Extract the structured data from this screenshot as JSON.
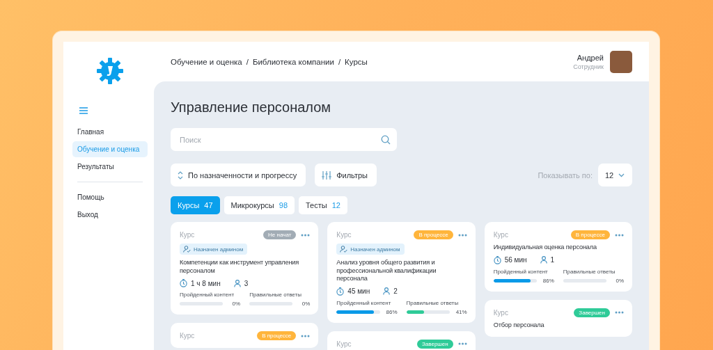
{
  "sidebar": {
    "items": [
      {
        "label": "Главная",
        "selected": false
      },
      {
        "label": "Обучение и оценка",
        "selected": true
      },
      {
        "label": "Результаты",
        "selected": false
      }
    ],
    "bottom_items": [
      {
        "label": "Помощь"
      },
      {
        "label": "Выход"
      }
    ]
  },
  "breadcrumbs": [
    "Обучение и оценка",
    "Библиотека компании",
    "Курсы"
  ],
  "breadcrumb_separator": "/",
  "user": {
    "name": "Андрей",
    "role": "Сотрудник"
  },
  "page_title": "Управление персоналом",
  "search": {
    "placeholder": "Поиск"
  },
  "sort_button": "По назначенности и прогрессу",
  "filter_button": "Фильтры",
  "page_size": {
    "label": "Показывать по:",
    "value": "12"
  },
  "tabs": [
    {
      "label": "Курсы",
      "count": "47",
      "selected": true
    },
    {
      "label": "Микрокурсы",
      "count": "98",
      "selected": false
    },
    {
      "label": "Тесты",
      "count": "12",
      "selected": false
    }
  ],
  "columns": [
    [
      {
        "type": "Курс",
        "status": {
          "label": "Не начат",
          "kind": "not_started"
        },
        "assigned": "Назначен админом",
        "title": "Компетенции как инструмент управления персоналом",
        "duration": "1 ч 8 мин",
        "people": "3",
        "metrics": [
          {
            "label": "Пройденный контент",
            "level": 0,
            "reading": "0%",
            "kind": "content"
          },
          {
            "label": "Правильные ответы",
            "level": 0,
            "reading": "0%",
            "kind": "answers"
          }
        ]
      },
      {
        "type": "Курс",
        "status": {
          "label": "В процессе",
          "kind": "in_progress"
        }
      }
    ],
    [
      {
        "type": "Курс",
        "status": {
          "label": "В процессе",
          "kind": "in_progress"
        },
        "assigned": "Назначен админом",
        "title": "Анализ уровня общего развития и профессиональной квалификации персонала",
        "duration": "45 мин",
        "people": "2",
        "metrics": [
          {
            "label": "Пройденный контент",
            "level": 0.86,
            "reading": "86%",
            "kind": "content"
          },
          {
            "label": "Правильные ответы",
            "level": 0.41,
            "reading": "41%",
            "kind": "answers"
          }
        ]
      },
      {
        "type": "Курс",
        "status": {
          "label": "Завершен",
          "kind": "done"
        }
      }
    ],
    [
      {
        "type": "Курс",
        "status": {
          "label": "В процессе",
          "kind": "in_progress"
        },
        "title": "Индивидуальная оценка персонала",
        "duration": "56 мин",
        "people": "1",
        "metrics": [
          {
            "label": "Пройденный контент",
            "level": 0.86,
            "reading": "86%",
            "kind": "content"
          },
          {
            "label": "Правильные ответы",
            "level": 0,
            "reading": "0%",
            "kind": "answers"
          }
        ]
      },
      {
        "type": "Курс",
        "status": {
          "label": "Завершен",
          "kind": "done"
        },
        "title": "Отбор персонала"
      }
    ]
  ]
}
